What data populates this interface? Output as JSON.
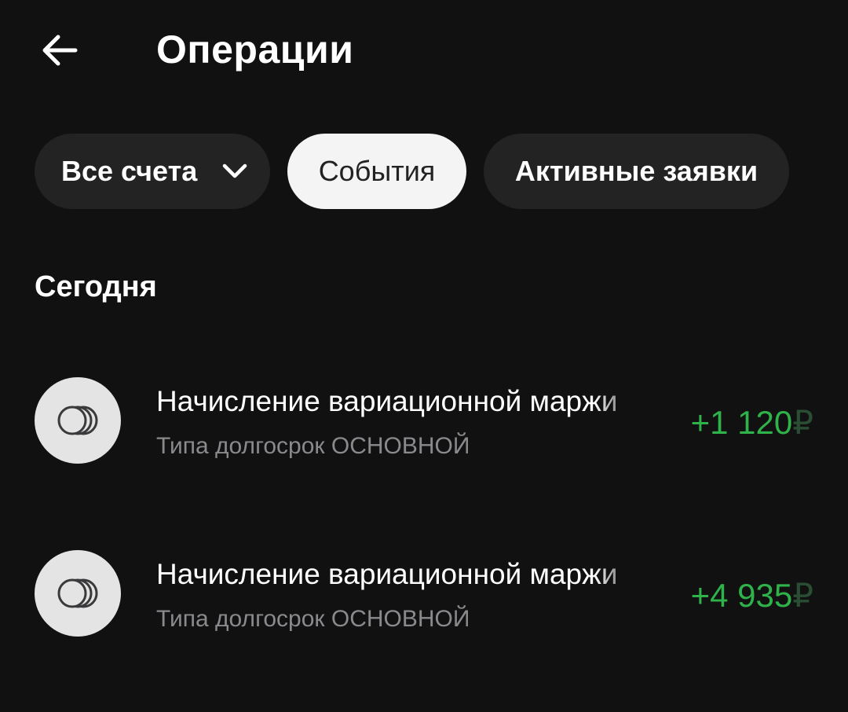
{
  "header": {
    "back_icon": "arrow-left-icon",
    "title": "Операции"
  },
  "filters": {
    "accounts_label": "Все счета",
    "accounts_icon": "chevron-down-icon",
    "events_label": "События",
    "active_orders_label": "Активные заявки",
    "selected": "События"
  },
  "section": {
    "title": "Сегодня"
  },
  "operations": [
    {
      "icon": "coins-icon",
      "title": "Начисление вариационной маржи",
      "subtitle": "Типа долгосрок ОСНОВНОЙ",
      "amount": "+1 120",
      "currency": "₽"
    },
    {
      "icon": "coins-icon",
      "title": "Начисление вариационной маржи",
      "subtitle": "Типа долгосрок ОСНОВНОЙ",
      "amount": "+4 935",
      "currency": "₽"
    }
  ],
  "colors": {
    "background": "#111111",
    "chip": "#232323",
    "chip_selected": "#f4f4f4",
    "positive_amount": "#2fb24a",
    "secondary_text": "#8a8a8e"
  }
}
